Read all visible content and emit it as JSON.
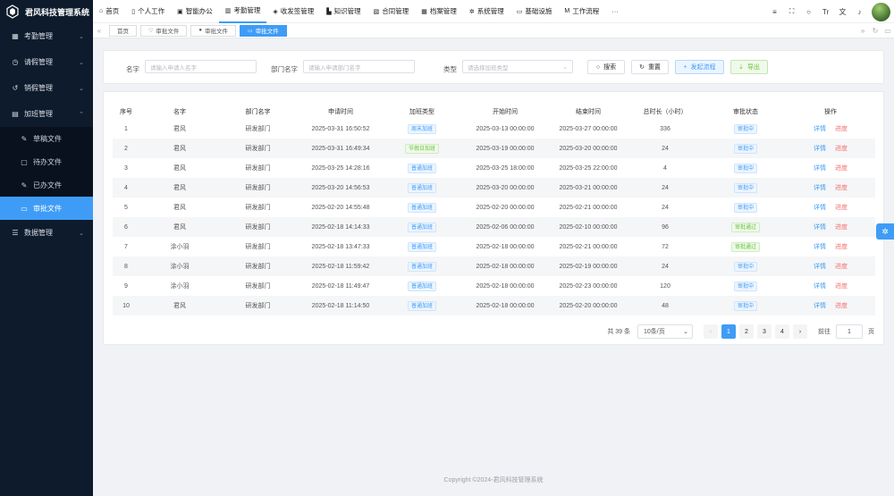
{
  "app": {
    "title": "君风科技管理系统"
  },
  "sidebar": {
    "items": [
      {
        "label": "考勤管理",
        "arrow": "⌄"
      },
      {
        "label": "请假管理",
        "arrow": "⌄"
      },
      {
        "label": "销假管理",
        "arrow": "⌄"
      },
      {
        "label": "加班管理",
        "arrow": "⌃"
      }
    ],
    "subitems": [
      {
        "label": "草稿文件"
      },
      {
        "label": "待办文件"
      },
      {
        "label": "已办文件"
      },
      {
        "label": "审批文件"
      }
    ],
    "after": [
      {
        "label": "数据管理",
        "arrow": "⌄"
      }
    ]
  },
  "topnav": {
    "items": [
      "首页",
      "个人工作",
      "智能办公",
      "考勤管理",
      "收发签管理",
      "知识管理",
      "合同管理",
      "档案管理",
      "系统管理",
      "基础设施",
      "工作流程"
    ],
    "more": "···"
  },
  "tabs": {
    "items": [
      "首页",
      "审批文件",
      "审批文件",
      "审批文件"
    ]
  },
  "search": {
    "name_label": "名字",
    "name_placeholder": "请输入申请人名字",
    "dept_label": "部门名字",
    "dept_placeholder": "请输入申请部门名字",
    "type_label": "类型",
    "type_placeholder": "请选择加班类型",
    "search_btn": "搜索",
    "reset_btn": "重置",
    "start_btn": "发起流程",
    "export_btn": "导出"
  },
  "table": {
    "headers": [
      "序号",
      "名字",
      "部门名字",
      "申请时间",
      "加班类型",
      "开始时间",
      "结束时间",
      "总时长（小时）",
      "审批状态",
      "操作"
    ],
    "rows": [
      {
        "no": "1",
        "name": "君风",
        "dept": "研发部门",
        "apply": "2025-03-31 16:50:52",
        "type": "周末加班",
        "tg": "blue",
        "start": "2025-03-13 00:00:00",
        "end": "2025-03-27 00:00:00",
        "hours": "336",
        "status": "审批中",
        "sg": "blue"
      },
      {
        "no": "2",
        "name": "君风",
        "dept": "研发部门",
        "apply": "2025-03-31 16:49:34",
        "type": "节假日加班",
        "tg": "green",
        "start": "2025-03-19 00:00:00",
        "end": "2025-03-20 00:00:00",
        "hours": "24",
        "status": "审批中",
        "sg": "blue"
      },
      {
        "no": "3",
        "name": "君风",
        "dept": "研发部门",
        "apply": "2025-03-25 14:28:16",
        "type": "普通加班",
        "tg": "blue",
        "start": "2025-03-25 18:00:00",
        "end": "2025-03-25 22:00:00",
        "hours": "4",
        "status": "审批中",
        "sg": "blue"
      },
      {
        "no": "4",
        "name": "君风",
        "dept": "研发部门",
        "apply": "2025-03-20 14:56:53",
        "type": "普通加班",
        "tg": "blue",
        "start": "2025-03-20 00:00:00",
        "end": "2025-03-21 00:00:00",
        "hours": "24",
        "status": "审批中",
        "sg": "blue"
      },
      {
        "no": "5",
        "name": "君风",
        "dept": "研发部门",
        "apply": "2025-02-20 14:55:48",
        "type": "普通加班",
        "tg": "blue",
        "start": "2025-02-20 00:00:00",
        "end": "2025-02-21 00:00:00",
        "hours": "24",
        "status": "审批中",
        "sg": "blue"
      },
      {
        "no": "6",
        "name": "君风",
        "dept": "研发部门",
        "apply": "2025-02-18 14:14:33",
        "type": "普通加班",
        "tg": "blue",
        "start": "2025-02-06 00:00:00",
        "end": "2025-02-10 00:00:00",
        "hours": "96",
        "status": "审批通过",
        "sg": "green"
      },
      {
        "no": "7",
        "name": "涂小羽",
        "dept": "研发部门",
        "apply": "2025-02-18 13:47:33",
        "type": "普通加班",
        "tg": "blue",
        "start": "2025-02-18 00:00:00",
        "end": "2025-02-21 00:00:00",
        "hours": "72",
        "status": "审批通过",
        "sg": "green"
      },
      {
        "no": "8",
        "name": "涂小羽",
        "dept": "研发部门",
        "apply": "2025-02-18 11:59:42",
        "type": "普通加班",
        "tg": "blue",
        "start": "2025-02-18 00:00:00",
        "end": "2025-02-19 00:00:00",
        "hours": "24",
        "status": "审批中",
        "sg": "blue"
      },
      {
        "no": "9",
        "name": "涂小羽",
        "dept": "研发部门",
        "apply": "2025-02-18 11:49:47",
        "type": "普通加班",
        "tg": "blue",
        "start": "2025-02-18 00:00:00",
        "end": "2025-02-23 00:00:00",
        "hours": "120",
        "status": "审批中",
        "sg": "blue"
      },
      {
        "no": "10",
        "name": "君风",
        "dept": "研发部门",
        "apply": "2025-02-18 11:14:50",
        "type": "普通加班",
        "tg": "blue",
        "start": "2025-02-18 00:00:00",
        "end": "2025-02-20 00:00:00",
        "hours": "48",
        "status": "审批中",
        "sg": "blue"
      }
    ],
    "detail": "详情",
    "progress": "进度"
  },
  "pager": {
    "total": "共 39 条",
    "size": "10条/页",
    "prev": "‹",
    "next": "›",
    "pages": [
      "1",
      "2",
      "3",
      "4"
    ],
    "goto": "前往",
    "goto_val": "1",
    "unit": "页"
  },
  "footer": {
    "text": "Copyright ©2024-君风科技管理系统"
  }
}
